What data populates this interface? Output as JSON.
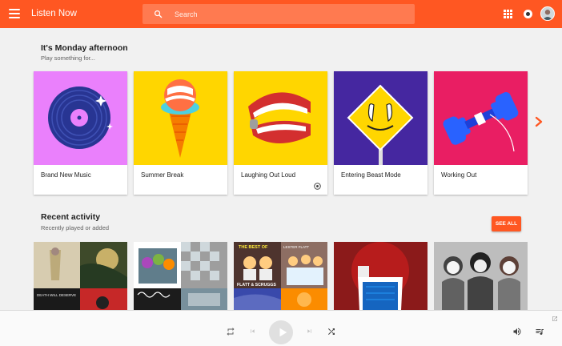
{
  "header": {
    "app_title": "Listen Now",
    "search_placeholder": "Search"
  },
  "icons": {
    "menu": "hamburger-menu-icon",
    "search": "search-icon",
    "apps": "apps-grid-icon",
    "notifications": "notification-icon",
    "next": "chevron-right-icon",
    "repeat": "repeat-icon",
    "previous": "skip-previous-icon",
    "play": "play-icon",
    "next_track": "skip-next-icon",
    "shuffle": "shuffle-icon",
    "volume": "volume-icon",
    "queue": "queue-music-icon",
    "expand": "open-in-new-icon"
  },
  "colors": {
    "accent": "#ff5722",
    "background": "#f1f1f1"
  },
  "recommendations": {
    "title": "It's Monday afternoon",
    "subtitle": "Play something for...",
    "cards": [
      {
        "label": "Brand New Music"
      },
      {
        "label": "Summer Break"
      },
      {
        "label": "Laughing Out Loud"
      },
      {
        "label": "Entering Beast Mode"
      },
      {
        "label": "Working Out"
      }
    ]
  },
  "recent": {
    "title": "Recent activity",
    "subtitle": "Recently played or added",
    "see_all_label": "SEE ALL",
    "album_text": {
      "a1_caption": "DEATH WILL DESERVE",
      "a3_title": "THE BEST OF",
      "a3_name": "FLATT & SCRUGGS",
      "a3_top": "LESTER FLATT"
    }
  }
}
